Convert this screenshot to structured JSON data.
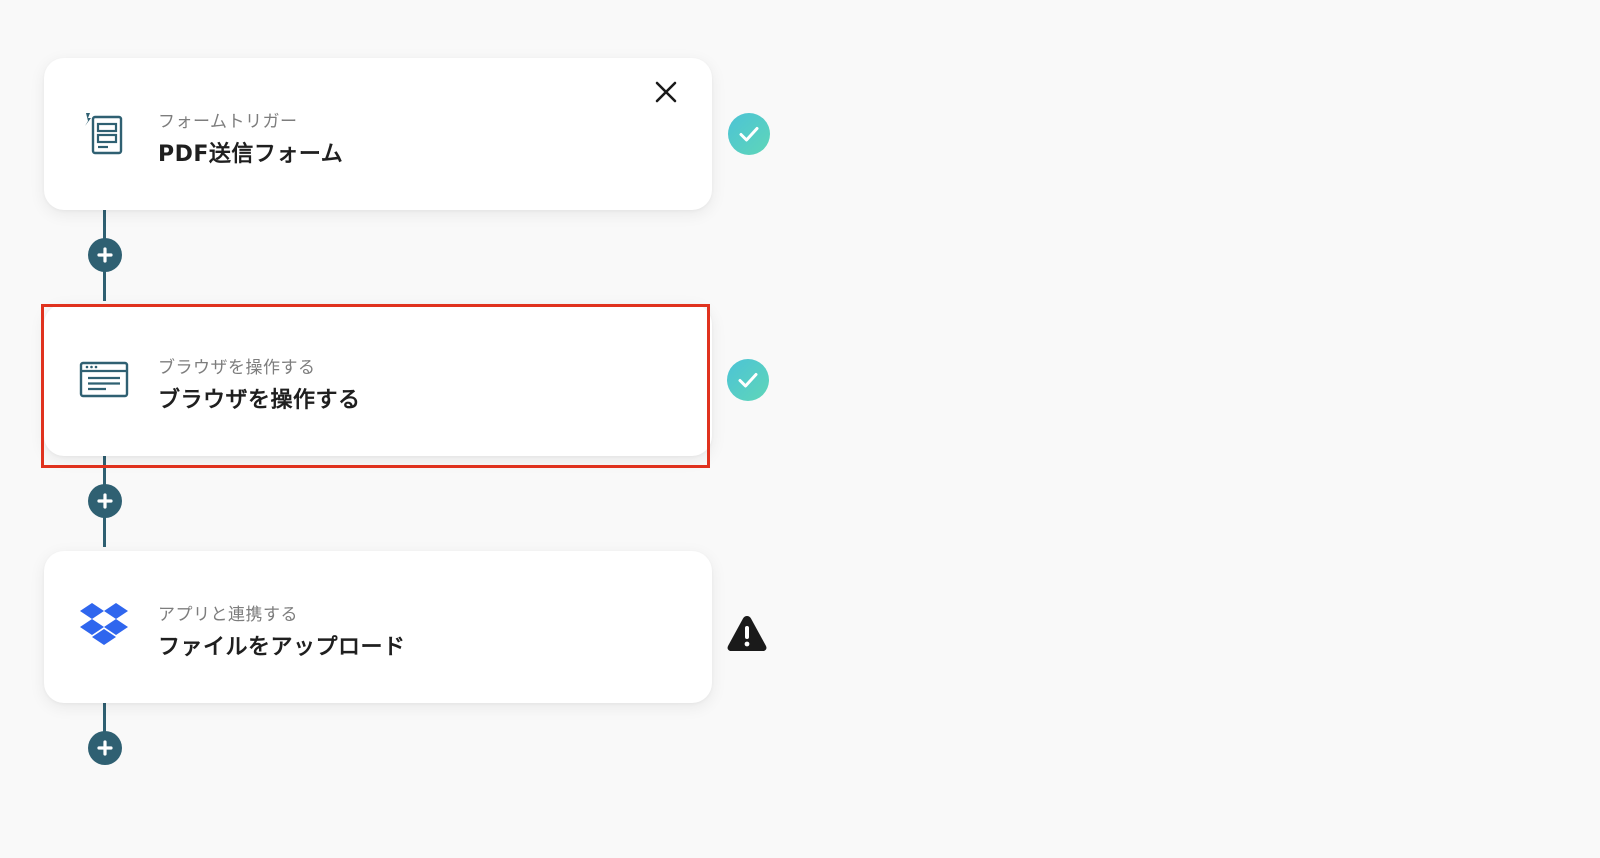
{
  "flow": {
    "steps": [
      {
        "label": "フォームトリガー",
        "title": "PDF送信フォーム",
        "icon": "form-trigger-icon",
        "status": "complete",
        "has_close": true
      },
      {
        "label": "ブラウザを操作する",
        "title": "ブラウザを操作する",
        "icon": "browser-window-icon",
        "status": "complete",
        "highlighted": true
      },
      {
        "label": "アプリと連携する",
        "title": "ファイルをアップロード",
        "icon": "dropbox-icon",
        "status": "warning"
      }
    ],
    "add_step_icon": "plus-icon"
  },
  "colors": {
    "background": "#f9f9f9",
    "connector": "#2f6072",
    "highlight_border": "#e0321e",
    "check_gradient_start": "#4cc3d6",
    "check_gradient_end": "#5fd6b8",
    "dropbox_blue": "#2f66ee",
    "warning": "#1a1a1a"
  }
}
